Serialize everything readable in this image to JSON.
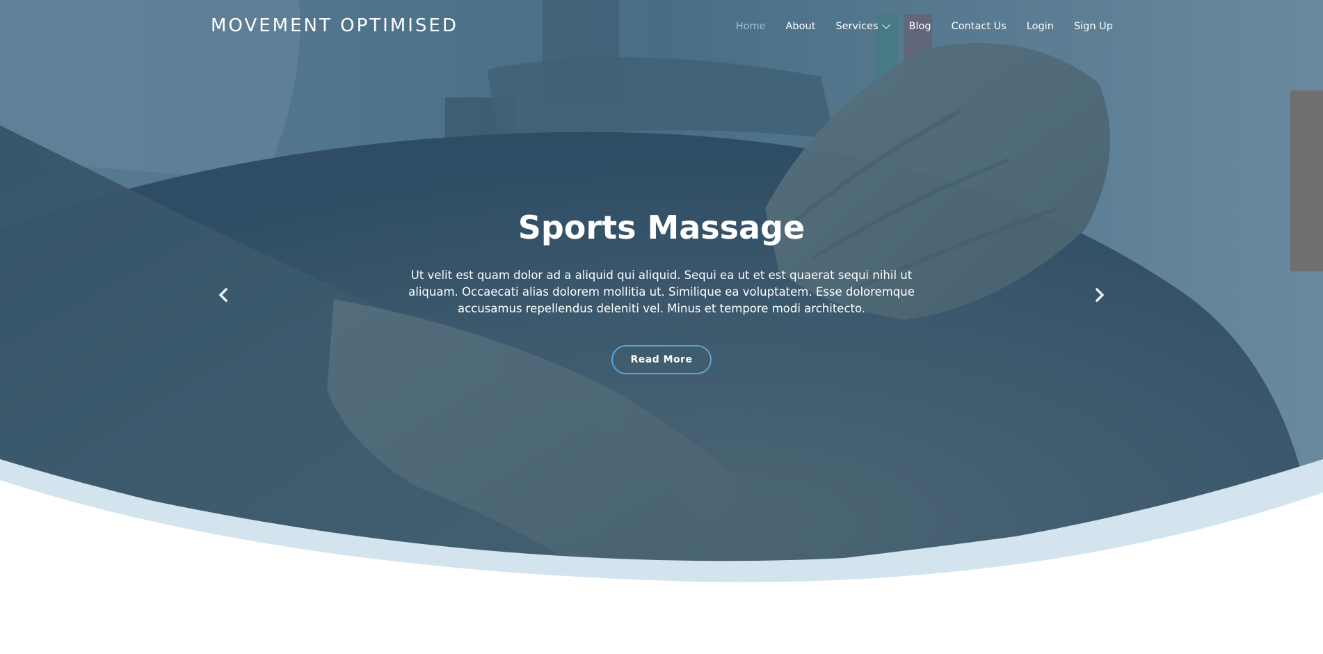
{
  "header": {
    "logo": "MOVEMENT OPTIMISED",
    "nav": [
      {
        "label": "Home",
        "active": true
      },
      {
        "label": "About"
      },
      {
        "label": "Services",
        "dropdown": true
      },
      {
        "label": "Blog"
      },
      {
        "label": "Contact Us"
      },
      {
        "label": "Login"
      },
      {
        "label": "Sign Up"
      }
    ]
  },
  "hero": {
    "title": "Sports Massage",
    "text": "Ut velit est quam dolor ad a aliquid qui aliquid. Sequi ea ut et est quaerat sequi nihil ut aliquam. Occaecati alias dolorem mollitia ut. Similique ea voluptatem. Esse doloremque accusamus repellendus deleniti vel. Minus et tempore modi architecto.",
    "button_label": "Read More",
    "prev_icon": "chevron-left-icon",
    "next_icon": "chevron-right-icon"
  },
  "colors": {
    "overlay": "#2f5873",
    "accent": "#5aa6d6",
    "active_nav": "#8fc3e6",
    "wave_light": "#d3e4ee",
    "background": "#ffffff"
  }
}
